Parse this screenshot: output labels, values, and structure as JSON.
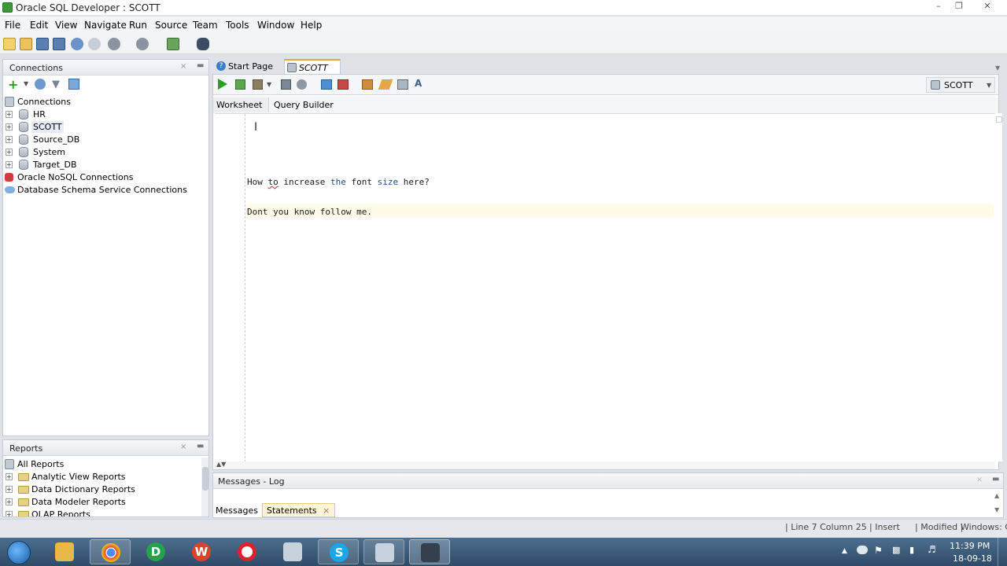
{
  "window": {
    "title": "Oracle SQL Developer : SCOTT"
  },
  "menu": [
    "File",
    "Edit",
    "View",
    "Navigate",
    "Run",
    "Source",
    "Team",
    "Tools",
    "Window",
    "Help"
  ],
  "connections": {
    "title": "Connections",
    "root": "Connections",
    "items": [
      "HR",
      "SCOTT",
      "Source_DB",
      "System",
      "Target_DB"
    ],
    "extra": [
      "Oracle NoSQL Connections",
      "Database Schema Service Connections"
    ]
  },
  "reports": {
    "title": "Reports",
    "root": "All Reports",
    "items": [
      "Analytic View Reports",
      "Data Dictionary Reports",
      "Data Modeler Reports",
      "OLAP Reports"
    ]
  },
  "tabs": [
    {
      "label": "Start Page"
    },
    {
      "label": "SCOTT"
    }
  ],
  "subtabs": [
    "Worksheet",
    "Query Builder"
  ],
  "connection_selector": "SCOTT",
  "editor": {
    "line1": {
      "a": "How ",
      "b": "to",
      "c": " increase ",
      "d": "the",
      "e": " font ",
      "f": "size",
      "g": " here?"
    },
    "line2": "Dont you know follow me."
  },
  "messages": {
    "title": "Messages - Log",
    "tabs": [
      "Messages",
      "Statements"
    ]
  },
  "statusbar": {
    "position": "Line 7 Column 25",
    "mode": "Insert",
    "modified": "Modified",
    "os": "Windows: C"
  },
  "clock": {
    "time": "11:39 PM",
    "date": "18-09-18"
  },
  "colors": {
    "accent": "#3d8ee0",
    "keyword": "#1f4e8c",
    "taskbar": "#2e4b66"
  }
}
